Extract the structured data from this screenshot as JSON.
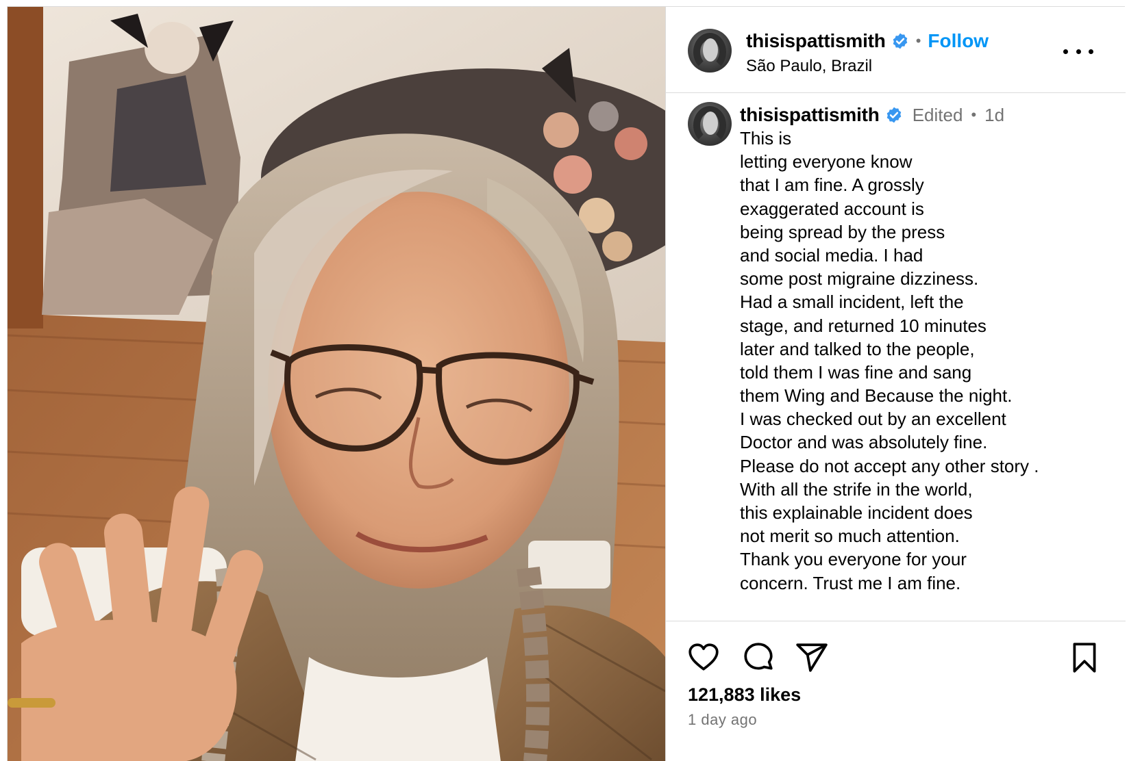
{
  "post": {
    "username": "thisispattismith",
    "verified": true,
    "follow_label": "Follow",
    "location": "São Paulo, Brazil",
    "more_icon": "more-options-icon"
  },
  "photo": {
    "alt": "Selfie of a woman with long grey hair and glasses waving, in front of a wall painting"
  },
  "caption": {
    "username": "thisispattismith",
    "edited_label": "Edited",
    "time": "1d",
    "lines": [
      "This is",
      "letting everyone know",
      "that I am fine. A grossly",
      "exaggerated account is",
      "being spread by the press",
      "and social media. I had",
      "some post migraine dizziness.",
      "Had a small incident, left the",
      "stage, and returned 10 minutes",
      "later and talked to the people,",
      "told them I was fine and sang",
      "them Wing and Because the night.",
      "I was checked out by an excellent",
      "Doctor and was absolutely fine.",
      "Please do not accept any other story .",
      "With all the strife in the world,",
      "this explainable incident does",
      "not merit so much attention.",
      "Thank you everyone for your",
      "concern. Trust me I am fine."
    ]
  },
  "actions": {
    "like_icon": "heart-icon",
    "comment_icon": "comment-icon",
    "share_icon": "share-icon",
    "save_icon": "bookmark-icon",
    "likes_text": "121,883 likes",
    "time_ago": "1 day ago"
  },
  "colors": {
    "link_blue": "#0095f6",
    "verified_blue": "#3897f0",
    "muted_text": "#737373",
    "border": "#dbdbdb"
  }
}
